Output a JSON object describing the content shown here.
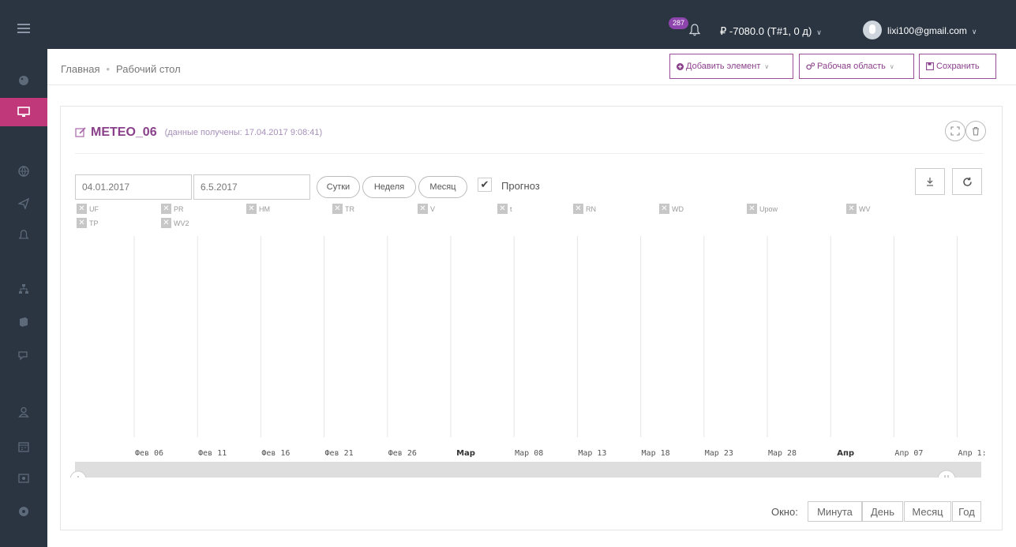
{
  "topbar": {
    "notifications_count": "287",
    "balance": "₽ -7080.0 (T#1, 0 д)",
    "user_email": "lixi100@gmail.com"
  },
  "breadcrumb": {
    "home": "Главная",
    "current": "Рабочий стол"
  },
  "toolbar": {
    "add_element": "Добавить элемент",
    "workspace": "Рабочая область",
    "save": "Сохранить"
  },
  "widget": {
    "title": "METEO_06",
    "subtitle": "(данные получены: 17.04.2017 9:08:41)"
  },
  "controls": {
    "date_from": "04.01.2017",
    "date_to": "6.5.2017",
    "btn_day": "Сутки",
    "btn_week": "Неделя",
    "btn_month": "Месяц",
    "forecast_label": "Прогноз",
    "forecast_checked": true
  },
  "legend": [
    "UF",
    "PR",
    "HM",
    "TR",
    "V",
    "t",
    "RN",
    "WD",
    "Upow",
    "WV",
    "TP",
    "WV2"
  ],
  "chart_data": {
    "type": "line",
    "x_ticks": [
      "Фев 06",
      "Фев 11",
      "Фев 16",
      "Фев 21",
      "Фев 26",
      "Мар",
      "Мар 08",
      "Мар 13",
      "Мар 18",
      "Мар 23",
      "Мар 28",
      "Апр",
      "Апр 07",
      "Апр 1:"
    ],
    "bold_ticks": [
      "Мар",
      "Апр"
    ],
    "navigator_ticks": [
      "Фев 06",
      "Фев 11",
      "Фев 16",
      "Фев 21",
      "Фев 26",
      "Мар",
      "Мар 08",
      "Мар 13",
      "Мар 18",
      "Мар 23",
      "Мар 28",
      "Апр",
      "Апр 07",
      "Апр"
    ],
    "series": [],
    "grid": "vertical"
  },
  "window": {
    "label": "Окно:",
    "minute": "Минута",
    "day": "День",
    "month": "Месяц",
    "year": "Год"
  },
  "colors": {
    "topbar": "#2b3542",
    "accent": "#8a3f8a",
    "active_sidebar": "#c0377a"
  }
}
